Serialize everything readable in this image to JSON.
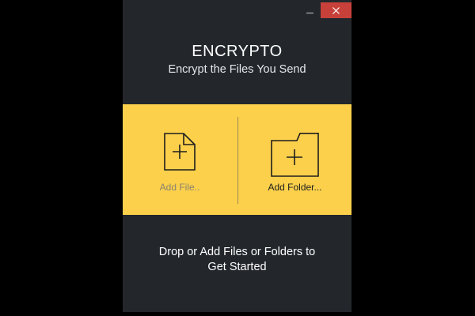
{
  "window": {
    "minimize_icon": "minimize-icon",
    "close_icon": "close-icon"
  },
  "header": {
    "title": "ENCRYPTO",
    "subtitle": "Encrypt the Files You Send"
  },
  "actions": {
    "add_file": {
      "label": "Add File..",
      "icon": "file-plus-icon"
    },
    "add_folder": {
      "label": "Add Folder...",
      "icon": "folder-plus-icon"
    }
  },
  "drop_zone": {
    "line1": "Drop or Add Files or Folders to",
    "line2": "Get Started"
  },
  "colors": {
    "background": "#23272c",
    "accent": "#fcd04b",
    "close": "#c7403a"
  }
}
